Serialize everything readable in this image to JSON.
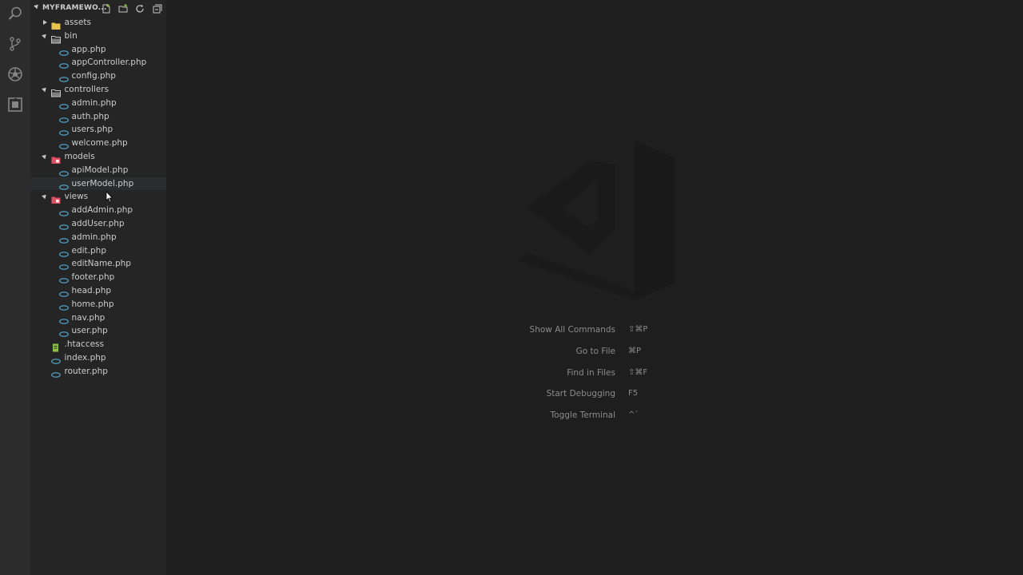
{
  "explorer": {
    "root_title": "MYFRAMEWO...",
    "tree": [
      {
        "label": "assets",
        "type": "folder",
        "icon": "folder-icon",
        "state": "collapsed",
        "depth": 0
      },
      {
        "label": "bin",
        "type": "folder-open",
        "icon": "folder-open-icon",
        "state": "expanded",
        "depth": 0
      },
      {
        "label": "app.php",
        "type": "php",
        "icon": "php-file-icon",
        "depth": 1
      },
      {
        "label": "appController.php",
        "type": "php",
        "icon": "php-file-icon",
        "depth": 1
      },
      {
        "label": "config.php",
        "type": "php",
        "icon": "php-file-icon",
        "depth": 1
      },
      {
        "label": "controllers",
        "type": "folder-open",
        "icon": "folder-open-icon",
        "state": "expanded",
        "depth": 0
      },
      {
        "label": "admin.php",
        "type": "php",
        "icon": "php-file-icon",
        "depth": 1
      },
      {
        "label": "auth.php",
        "type": "php",
        "icon": "php-file-icon",
        "depth": 1
      },
      {
        "label": "users.php",
        "type": "php",
        "icon": "php-file-icon",
        "depth": 1
      },
      {
        "label": "welcome.php",
        "type": "php",
        "icon": "php-file-icon",
        "depth": 1
      },
      {
        "label": "models",
        "type": "folder-red",
        "icon": "models-folder-icon",
        "state": "expanded",
        "depth": 0
      },
      {
        "label": "apiModel.php",
        "type": "php",
        "icon": "php-file-icon",
        "depth": 1
      },
      {
        "label": "userModel.php",
        "type": "php",
        "icon": "php-file-icon",
        "depth": 1,
        "hover": true
      },
      {
        "label": "views",
        "type": "folder-red",
        "icon": "views-folder-icon",
        "state": "expanded",
        "depth": 0
      },
      {
        "label": "addAdmin.php",
        "type": "php",
        "icon": "php-file-icon",
        "depth": 1
      },
      {
        "label": "addUser.php",
        "type": "php",
        "icon": "php-file-icon",
        "depth": 1
      },
      {
        "label": "admin.php",
        "type": "php",
        "icon": "php-file-icon",
        "depth": 1
      },
      {
        "label": "edit.php",
        "type": "php",
        "icon": "php-file-icon",
        "depth": 1
      },
      {
        "label": "editName.php",
        "type": "php",
        "icon": "php-file-icon",
        "depth": 1
      },
      {
        "label": "footer.php",
        "type": "php",
        "icon": "php-file-icon",
        "depth": 1
      },
      {
        "label": "head.php",
        "type": "php",
        "icon": "php-file-icon",
        "depth": 1
      },
      {
        "label": "home.php",
        "type": "php",
        "icon": "php-file-icon",
        "depth": 1
      },
      {
        "label": "nav.php",
        "type": "php",
        "icon": "php-file-icon",
        "depth": 1
      },
      {
        "label": "user.php",
        "type": "php",
        "icon": "php-file-icon",
        "depth": 1
      },
      {
        "label": ".htaccess",
        "type": "htaccess",
        "icon": "htaccess-file-icon",
        "depth": 0
      },
      {
        "label": "index.php",
        "type": "php",
        "icon": "php-file-icon",
        "depth": 0
      },
      {
        "label": "router.php",
        "type": "php",
        "icon": "php-file-icon",
        "depth": 0
      }
    ]
  },
  "shortcuts": [
    {
      "label": "Show All Commands",
      "keys": "⇧⌘P"
    },
    {
      "label": "Go to File",
      "keys": "⌘P"
    },
    {
      "label": "Find in Files",
      "keys": "⇧⌘F"
    },
    {
      "label": "Start Debugging",
      "keys": "F5"
    },
    {
      "label": "Toggle Terminal",
      "keys": "^`"
    }
  ],
  "colors": {
    "php_icon": "#519aba",
    "folder_yellow": "#e8c34e",
    "folder_red": "#e04f5f",
    "htaccess_green": "#8dc149"
  }
}
